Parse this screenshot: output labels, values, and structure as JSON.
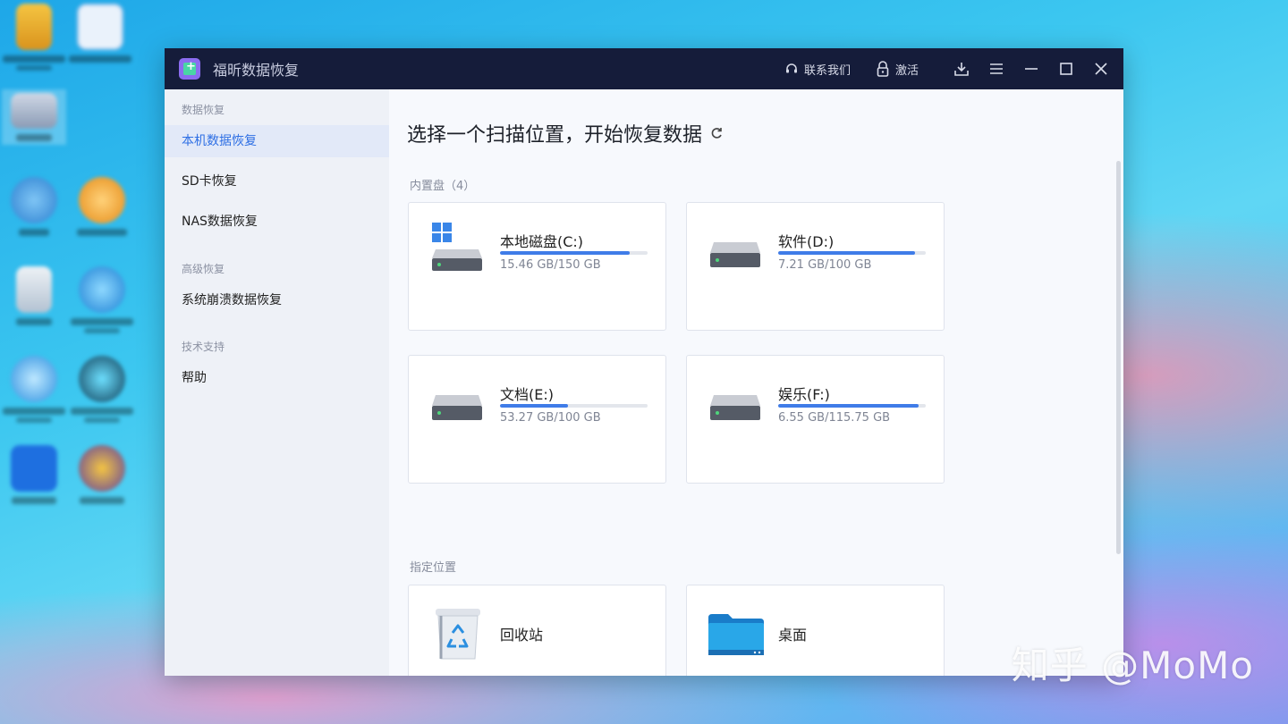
{
  "app": {
    "title": "福昕数据恢复"
  },
  "titlebar": {
    "contact_label": "联系我们",
    "activate_label": "激活"
  },
  "sidebar": {
    "groups": [
      {
        "label": "数据恢复",
        "items": [
          {
            "label": "本机数据恢复",
            "active": true
          },
          {
            "label": "SD卡恢复"
          },
          {
            "label": "NAS数据恢复"
          }
        ]
      },
      {
        "label": "高级恢复",
        "items": [
          {
            "label": "系统崩溃数据恢复"
          }
        ]
      },
      {
        "label": "技术支持",
        "items": [
          {
            "label": "帮助"
          }
        ]
      }
    ]
  },
  "main": {
    "heading": "选择一个扫描位置，开始恢复数据",
    "internal_label": "内置盘（4）",
    "drives": [
      {
        "name": "本地磁盘(C:)",
        "size": "15.46 GB/150 GB",
        "used_fraction": 0.88,
        "icon": "windows-hard-disk-icon"
      },
      {
        "name": "软件(D:)",
        "size": "7.21 GB/100 GB",
        "used_fraction": 0.93,
        "icon": "hard-disk-icon"
      },
      {
        "name": "文档(E:)",
        "size": "53.27 GB/100 GB",
        "used_fraction": 0.46,
        "icon": "hard-disk-icon"
      },
      {
        "name": "娱乐(F:)",
        "size": "6.55 GB/115.75 GB",
        "used_fraction": 0.95,
        "icon": "hard-disk-icon"
      }
    ],
    "location_label": "指定位置",
    "locations": [
      {
        "name": "回收站",
        "icon": "recycle-bin-icon"
      },
      {
        "name": "桌面",
        "icon": "desktop-folder-icon"
      }
    ]
  },
  "colors": {
    "titlebar_bg": "#151c3a",
    "accent": "#2e6fe4",
    "progress": "#3f7ce8"
  },
  "watermark": "知乎 @MoMo"
}
